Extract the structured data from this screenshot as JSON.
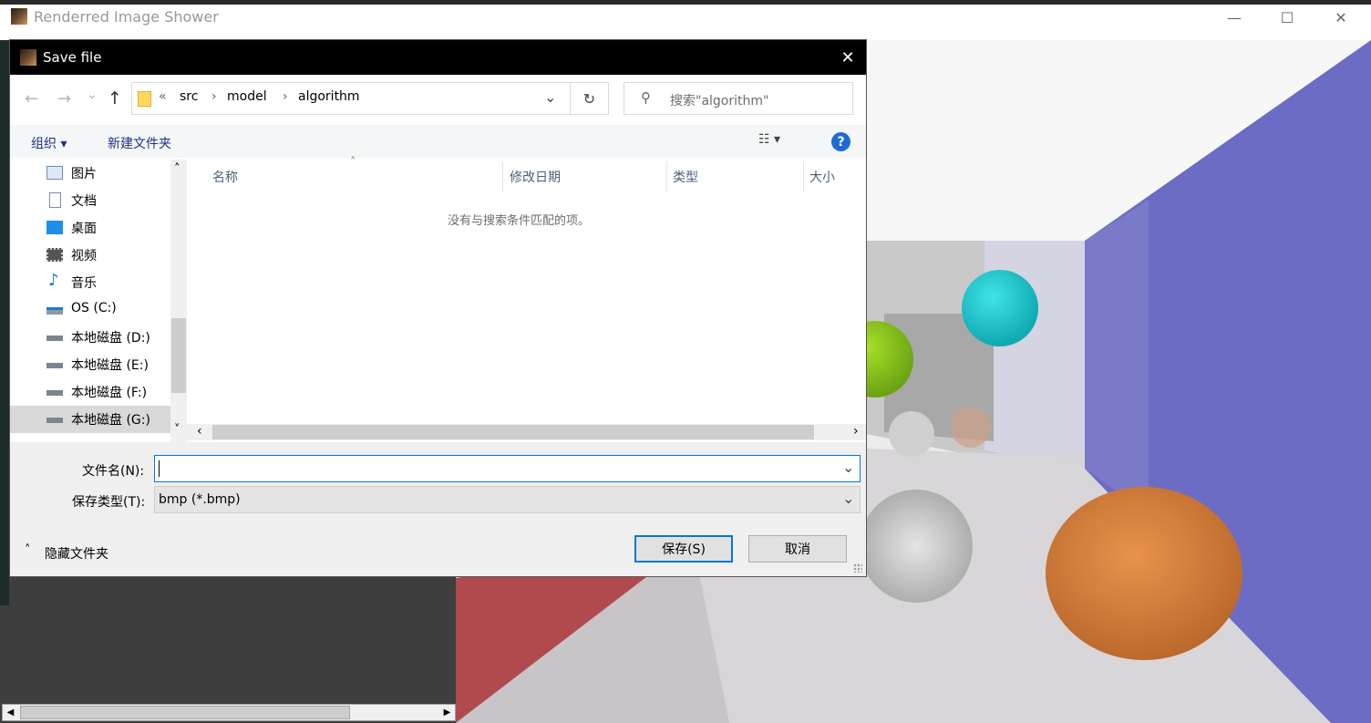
{
  "app": {
    "title": "Renderred Image Shower",
    "minimize_glyph": "—",
    "maximize_glyph": "☐",
    "close_glyph": "✕"
  },
  "dialog": {
    "title": "Save file",
    "close_glyph": "✕",
    "nav": {
      "back": "←",
      "forward": "→",
      "recent": "⌄",
      "up": "↑"
    },
    "address": {
      "overflow": "«",
      "crumbs": [
        "src",
        "model",
        "algorithm"
      ],
      "separator": "›",
      "dropdown": "⌄",
      "refresh": "↻"
    },
    "search": {
      "icon": "⚲",
      "placeholder": "搜索\"algorithm\""
    },
    "toolbar": {
      "organize": "组织 ▾",
      "new_folder": "新建文件夹",
      "view": "☷ ▾",
      "help": "?"
    },
    "nav_pane": {
      "items": [
        {
          "label": "图片",
          "icon": "pictures-icon"
        },
        {
          "label": "文档",
          "icon": "documents-icon"
        },
        {
          "label": "桌面",
          "icon": "desktop-icon"
        },
        {
          "label": "视频",
          "icon": "videos-icon"
        },
        {
          "label": "音乐",
          "icon": "music-icon"
        },
        {
          "label": "OS (C:)",
          "icon": "os-drive-icon"
        },
        {
          "label": "本地磁盘 (D:)",
          "icon": "drive-icon"
        },
        {
          "label": "本地磁盘 (E:)",
          "icon": "drive-icon"
        },
        {
          "label": "本地磁盘 (F:)",
          "icon": "drive-icon"
        },
        {
          "label": "本地磁盘 (G:)",
          "icon": "drive-icon",
          "selected": true
        }
      ],
      "scroll_up": "˄",
      "scroll_down": "˅"
    },
    "columns": [
      "名称",
      "修改日期",
      "类型",
      "大小"
    ],
    "sort_indicator": "˄",
    "empty_message": "没有与搜索条件匹配的项。",
    "hscroll": {
      "left": "‹",
      "right": "›"
    },
    "filename": {
      "label": "文件名(N):",
      "value": "",
      "dropdown": "⌄"
    },
    "filetype": {
      "label": "保存类型(T):",
      "value": "bmp (*.bmp)",
      "dropdown": "⌄"
    },
    "hide_folders": {
      "glyph": "˄",
      "label": "隐藏文件夹"
    },
    "save_button": "保存(S)",
    "cancel_button": "取消"
  },
  "scrollbar": {
    "left": "◀",
    "right": "▶"
  },
  "colors": {
    "accent": "#0078d7",
    "wall_blue": "#6c6cc4",
    "wall_red": "#b04a4e",
    "sphere_cyan": "#1cc6cc",
    "sphere_green": "#8fc81a",
    "sphere_orange": "#d9823f"
  }
}
